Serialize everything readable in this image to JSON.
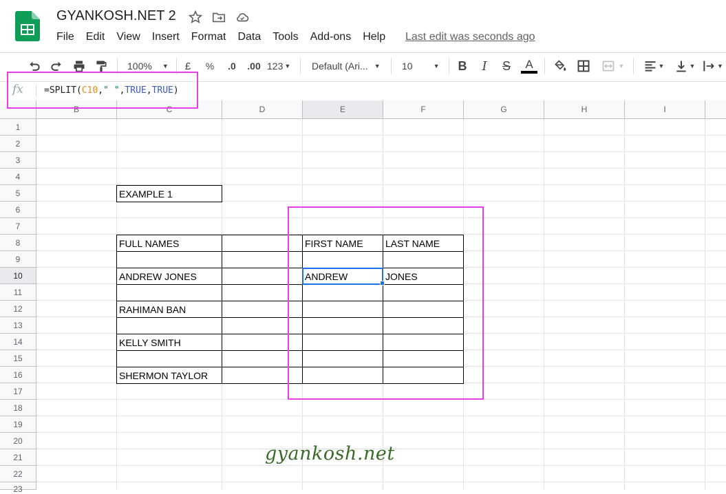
{
  "app": {
    "doc_title": "GYANKOSH.NET 2",
    "icons": [
      "sheets-logo-icon",
      "star-icon",
      "move-folder-icon",
      "cloud-saved-icon"
    ],
    "last_edit": "Last edit was seconds ago"
  },
  "menu": [
    "File",
    "Edit",
    "View",
    "Insert",
    "Format",
    "Data",
    "Tools",
    "Add-ons",
    "Help"
  ],
  "toolbar": {
    "zoom": "100%",
    "currency": "£",
    "percent": "%",
    "decrease_decimals": ".0",
    "increase_decimals": ".00",
    "more_formats": "123",
    "font": "Default (Ari...",
    "font_size": "10",
    "bold": "B",
    "italic": "I",
    "strikethrough": "S",
    "text_color": "A",
    "text_color_value": "#000000"
  },
  "formula_bar": {
    "fx_label": "fx",
    "formula_prefix": "=SPLIT(",
    "formula_ref": "C10",
    "formula_sep1": ",",
    "formula_str": "\" \"",
    "formula_sep2": ",",
    "formula_bool1": "TRUE",
    "formula_sep3": ",",
    "formula_bool2": "TRUE",
    "formula_suffix": ")"
  },
  "columns": [
    "B",
    "C",
    "D",
    "E",
    "F",
    "G",
    "H",
    "I"
  ],
  "selected_column": "E",
  "rows": [
    "1",
    "2",
    "3",
    "4",
    "5",
    "6",
    "7",
    "8",
    "9",
    "10",
    "11",
    "12",
    "13",
    "14",
    "15",
    "16",
    "17",
    "18",
    "19",
    "20",
    "21",
    "22",
    "23"
  ],
  "selected_row": "10",
  "cells": {
    "example_label": "EXAMPLE 1",
    "full_names_header": "FULL NAMES",
    "first_name_header": "FIRST NAME",
    "last_name_header": "LAST NAME",
    "c10": "ANDREW JONES",
    "c12": "RAHIMAN BAN",
    "c14": "KELLY SMITH",
    "c16": "SHERMON TAYLOR",
    "e10": "ANDREW",
    "f10": "JONES"
  },
  "watermark": "gyankosh.net",
  "colors": {
    "highlight": "#e83de8",
    "selection": "#1a73e8",
    "sheets_green": "#0f9d58",
    "watermark": "#3b6a2a"
  }
}
